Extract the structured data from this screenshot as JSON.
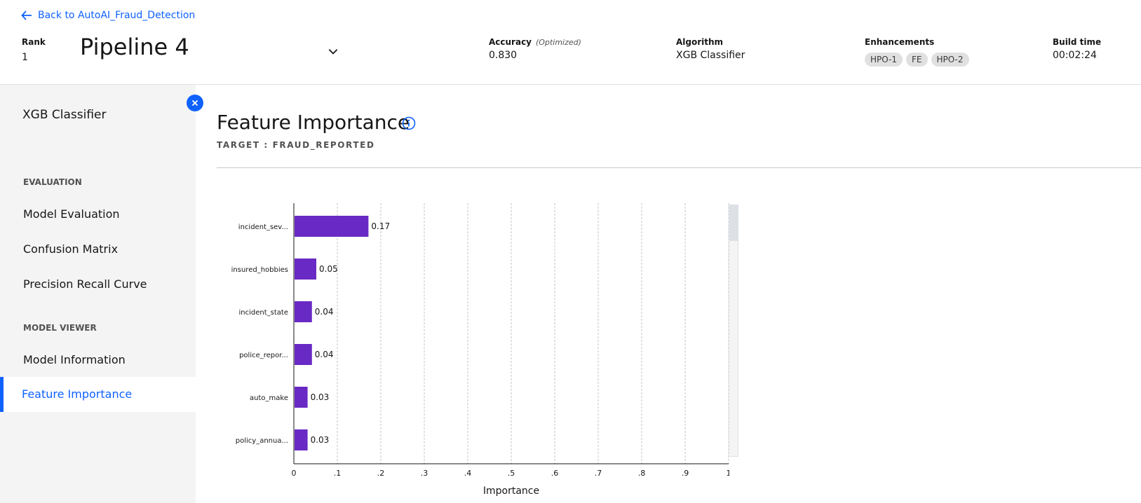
{
  "header": {
    "back_link": "Back to AutoAI_Fraud_Detection",
    "rank_label": "Rank",
    "rank_value": "1",
    "pipeline_name": "Pipeline 4",
    "accuracy_label": "Accuracy",
    "accuracy_note": "(Optimized)",
    "accuracy_value": "0.830",
    "algorithm_label": "Algorithm",
    "algorithm_value": "XGB Classifier",
    "enhancements_label": "Enhancements",
    "enhancements": [
      "HPO-1",
      "FE",
      "HPO-2"
    ],
    "build_time_label": "Build time",
    "build_time_value": "00:02:24"
  },
  "sidebar": {
    "title": "XGB Classifier",
    "evaluation_heading": "EVALUATION",
    "evaluation_items": [
      "Model Evaluation",
      "Confusion Matrix",
      "Precision Recall Curve"
    ],
    "viewer_heading": "MODEL VIEWER",
    "viewer_items": [
      "Model Information",
      "Feature Importance"
    ],
    "active_item": "Feature Importance"
  },
  "main": {
    "title": "Feature Importance",
    "target_label": "TARGET : FRAUD_REPORTED"
  },
  "colors": {
    "accent": "#0f62fe",
    "bar": "#6929c4",
    "sidebar_bg": "#f4f4f4"
  },
  "chart_data": {
    "type": "bar",
    "orientation": "horizontal",
    "categories": [
      "incident_sev...",
      "insured_hobbies",
      "incident_state",
      "police_repor...",
      "auto_make",
      "policy_annua..."
    ],
    "values": [
      0.17,
      0.05,
      0.04,
      0.04,
      0.03,
      0.03
    ],
    "value_labels": [
      "0.17",
      "0.05",
      "0.04",
      "0.04",
      "0.03",
      "0.03"
    ],
    "xlabel": "Importance",
    "ylabel": "",
    "xlim": [
      0,
      1
    ],
    "x_ticks": [
      0,
      0.1,
      0.2,
      0.3,
      0.4,
      0.5,
      0.6,
      0.7,
      0.8,
      0.9,
      1
    ],
    "x_tick_labels": [
      "0",
      ".1",
      ".2",
      ".3",
      ".4",
      ".5",
      ".6",
      ".7",
      ".8",
      ".9",
      "1"
    ],
    "grid": true
  }
}
